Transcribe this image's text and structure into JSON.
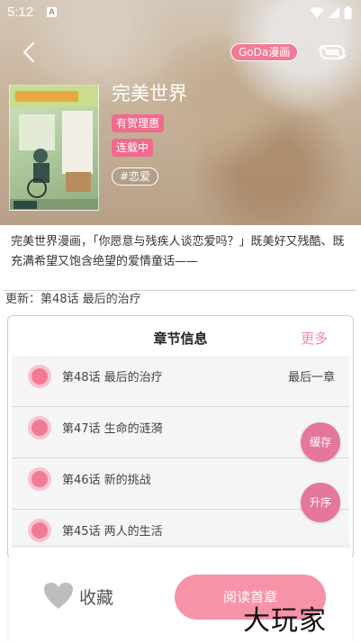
{
  "status": {
    "time": "5:12",
    "notification": "A"
  },
  "header": {
    "source": "GoDa漫画",
    "title": "完美世界"
  },
  "tags": [
    "有贺理惠",
    "连载中"
  ],
  "genre": "#恋爱",
  "description": "完美世界漫画，「你愿意与残疾人谈恋爱吗？」既美好又残酷、既充满希望又饱含绝望的爱情童话——",
  "update": "更新：第48话 最后的治疗",
  "chapters": {
    "title": "章节信息",
    "more": "更多",
    "items": [
      {
        "name": "第48话 最后的治疗",
        "tag": "最后一章"
      },
      {
        "name": "第47话 生命的涟漪",
        "tag": ""
      },
      {
        "name": "第46话 新的挑战",
        "tag": ""
      },
      {
        "name": "第45话 两人的生活",
        "tag": ""
      }
    ]
  },
  "fab": {
    "cache": "缓存",
    "sort": "升序"
  },
  "bottom": {
    "favorite": "收藏",
    "read": "阅读首章"
  },
  "watermark": "大玩家",
  "colors": {
    "accent": "#f27a95",
    "fab": "#e5779a",
    "read_button": "#f693a9"
  }
}
